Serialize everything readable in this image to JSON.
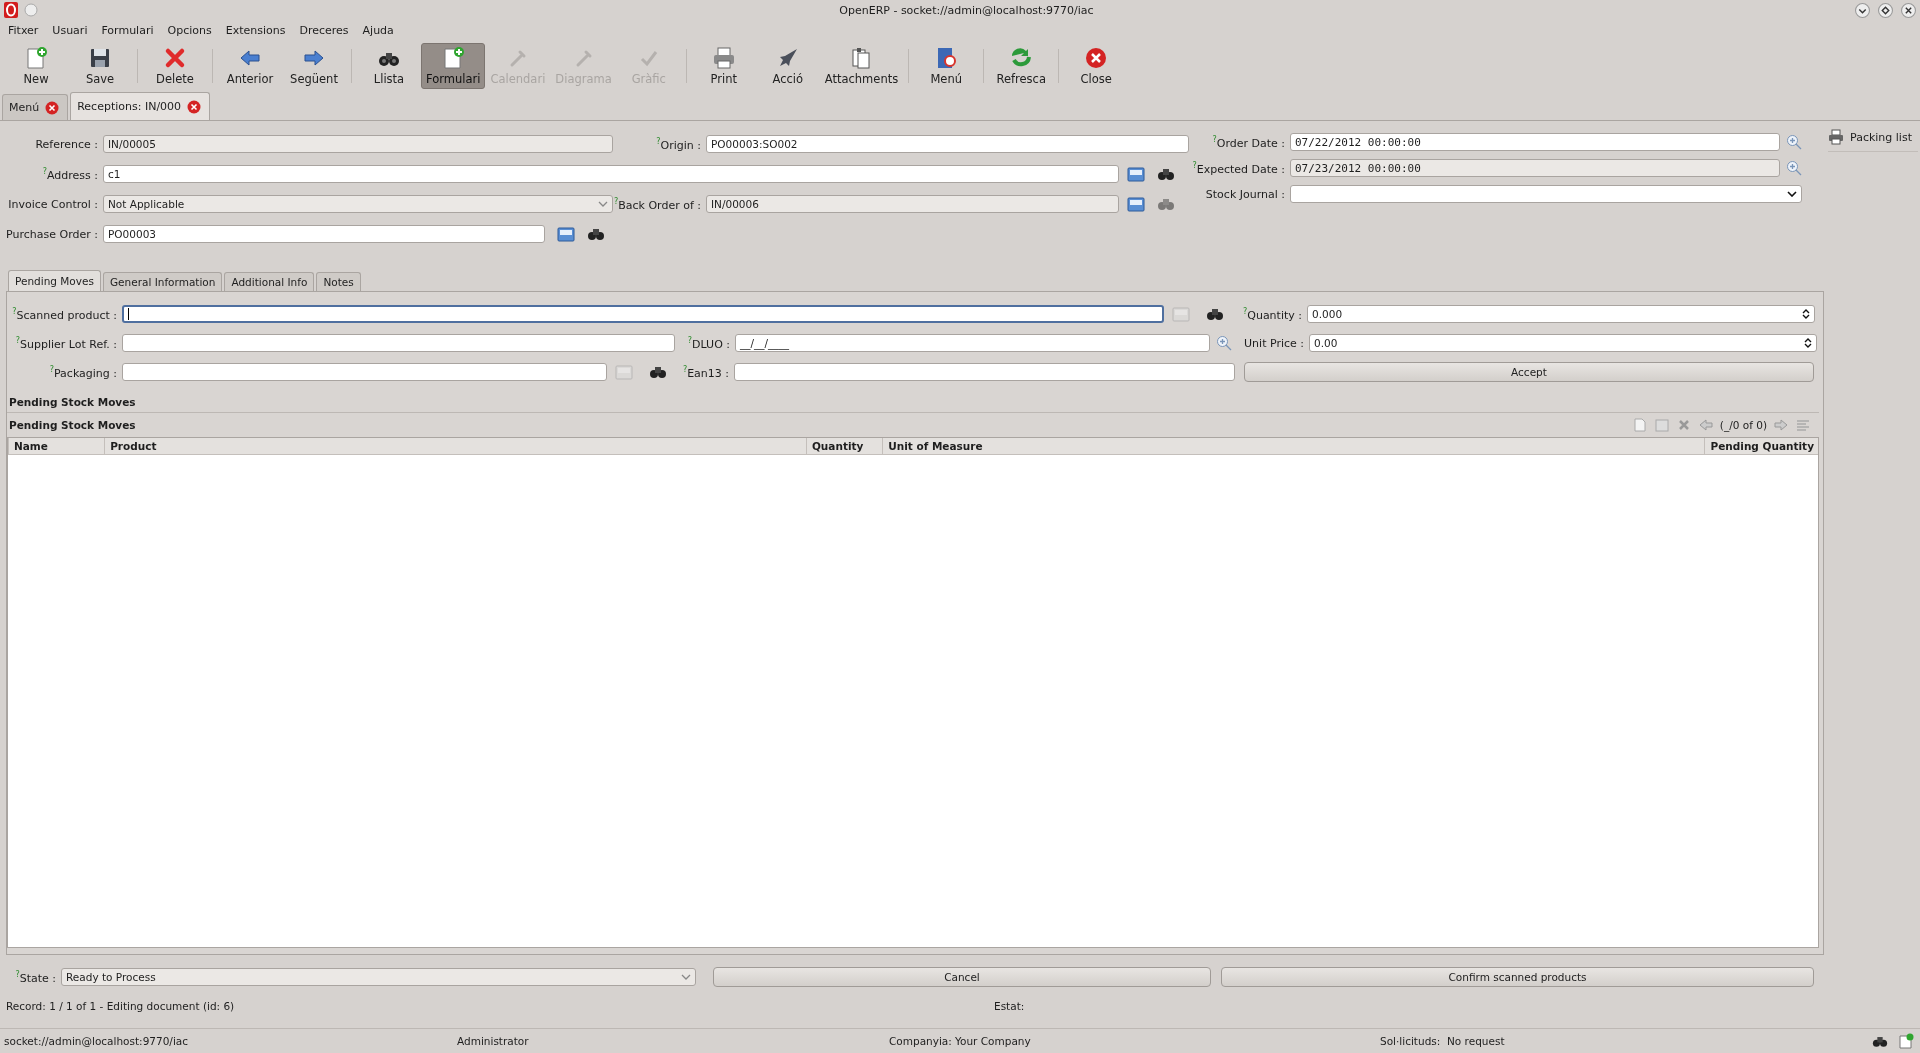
{
  "window": {
    "title": "OpenERP - socket://admin@localhost:9770/iac"
  },
  "menu": [
    "Fitxer",
    "Usuari",
    "Formulari",
    "Opcions",
    "Extensions",
    "Dreceres",
    "Ajuda"
  ],
  "toolbar": [
    {
      "label": "New",
      "kind": "new",
      "separated": false,
      "disabled": false,
      "selected": false
    },
    {
      "label": "Save",
      "kind": "save",
      "separated": false,
      "disabled": false,
      "selected": false
    },
    {
      "label": "Delete",
      "kind": "delete",
      "separated": true,
      "disabled": false,
      "selected": false
    },
    {
      "label": "Anterior",
      "kind": "prev",
      "separated": true,
      "disabled": false,
      "selected": false
    },
    {
      "label": "Següent",
      "kind": "next",
      "separated": false,
      "disabled": false,
      "selected": false
    },
    {
      "label": "Llista",
      "kind": "list",
      "separated": true,
      "disabled": false,
      "selected": false
    },
    {
      "label": "Formulari",
      "kind": "new",
      "separated": false,
      "disabled": false,
      "selected": true
    },
    {
      "label": "Calendari",
      "kind": "dropper",
      "separated": false,
      "disabled": true,
      "selected": false
    },
    {
      "label": "Diagrama",
      "kind": "dropper",
      "separated": false,
      "disabled": true,
      "selected": false
    },
    {
      "label": "Gràfic",
      "kind": "check",
      "separated": false,
      "disabled": true,
      "selected": false
    },
    {
      "label": "Print",
      "kind": "print",
      "separated": true,
      "disabled": false,
      "selected": false
    },
    {
      "label": "Acció",
      "kind": "rocket",
      "separated": false,
      "disabled": false,
      "selected": false
    },
    {
      "label": "Attachments",
      "kind": "attach",
      "separated": false,
      "disabled": false,
      "selected": false
    },
    {
      "label": "Menú",
      "kind": "book",
      "separated": true,
      "disabled": false,
      "selected": false
    },
    {
      "label": "Refresca",
      "kind": "refresh",
      "separated": true,
      "disabled": false,
      "selected": false
    },
    {
      "label": "Close",
      "kind": "close",
      "separated": true,
      "disabled": false,
      "selected": false
    }
  ],
  "doc_tabs": [
    {
      "label": "Menú",
      "selected": false
    },
    {
      "label": "Receptions: IN/000",
      "selected": true
    }
  ],
  "header": {
    "reference": {
      "label": "Reference :",
      "value": "IN/00005",
      "readonly": true
    },
    "origin": {
      "label": "$^{?}$Origin :",
      "value": "PO00003:SO002",
      "readonly": false
    },
    "address": {
      "label": "$^{?}$Address :",
      "value": "c1",
      "readonly": false
    },
    "invoice_control": {
      "label": "Invoice Control :",
      "value": "Not Applicable",
      "readonly": true
    },
    "back_order_of": {
      "label": "$^{?}$Back Order of :",
      "value": "IN/00006",
      "readonly": true
    },
    "purchase_order": {
      "label": "Purchase Order :",
      "value": "PO00003",
      "readonly": false
    },
    "order_date": {
      "label": "$^{?}$Order Date :",
      "value": "07/22/2012 00:00:00",
      "readonly": false
    },
    "expected_date": {
      "label": "$^{?}$Expected Date :",
      "value": "07/23/2012 00:00:00",
      "readonly": true
    },
    "stock_journal": {
      "label": "Stock Journal :",
      "readonly": false
    }
  },
  "notebook": {
    "tabs": [
      {
        "label": "Pending Moves",
        "selected": true
      },
      {
        "label": "General Information",
        "selected": false
      },
      {
        "label": "Additional Info",
        "selected": false
      },
      {
        "label": "Notes",
        "selected": false
      }
    ],
    "scanned_product": {
      "label": "$^{?}$Scanned product :",
      "focused": true
    },
    "quantity": {
      "label": "$^{?}$Quantity :",
      "value": "0.000"
    },
    "supplier_lot_ref": {
      "label": "$^{?}$Supplier Lot Ref. :"
    },
    "dluo": {
      "label": "$^{?}$DLUO :",
      "value": "__/__/____"
    },
    "unit_price": {
      "label": "Unit Price :",
      "value": "0.00"
    },
    "packaging": {
      "label": "$^{?}$Packaging :"
    },
    "ean13": {
      "label": "$^{?}$Ean13 :"
    },
    "accept_button": "Accept",
    "section_title": "Pending Stock Moves",
    "table": {
      "title": "Pending Stock Moves",
      "pager": "(_/0 of 0)",
      "columns": [
        "Name",
        "Product",
        "Quantity",
        "Unit of Measure",
        "Pending Quantity"
      ]
    }
  },
  "footer": {
    "state": {
      "label": "$^{?}$State :",
      "value": "Ready to Process"
    },
    "buttons": [
      "Cancel",
      "Confirm scanned products"
    ],
    "record": "Record: 1 / 1 of 1 - Editing document (id: 6)",
    "estat": "Estat:"
  },
  "sidebar": {
    "items": [
      "Packing list"
    ]
  },
  "status_bar": {
    "url": "socket://admin@localhost:9770/iac",
    "user": "Administrator",
    "company_label": "Companyia:",
    "company": "Your Company",
    "requests_label": "Sol·licituds:",
    "requests": "No request"
  }
}
